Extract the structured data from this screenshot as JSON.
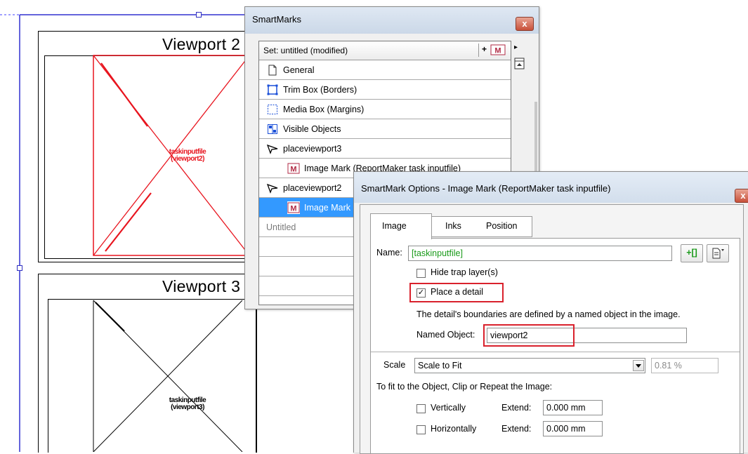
{
  "document": {
    "viewports": [
      {
        "title": "Viewport 2",
        "label_line1": "taskinputfile",
        "label_line2": "(viewport2)",
        "color": "#e8141e"
      },
      {
        "title": "Viewport 3",
        "label_line1": "taskinputfile",
        "label_line2": "(viewport3)",
        "color": "#000000"
      }
    ]
  },
  "smartmarks": {
    "title": "SmartMarks",
    "close_label": "x",
    "set_label": "Set: untitled (modified)",
    "add_label": "+",
    "add_icon": "image-mark-icon",
    "arrow_right": "▸",
    "items": [
      {
        "label": "General",
        "icon": "page-icon",
        "indent": 0
      },
      {
        "label": "Trim Box (Borders)",
        "icon": "trim-box-icon",
        "indent": 0
      },
      {
        "label": "Media Box (Margins)",
        "icon": "media-box-icon",
        "indent": 0
      },
      {
        "label": "Visible Objects",
        "icon": "visible-objects-icon",
        "indent": 0
      },
      {
        "label": "placeviewport3",
        "icon": "place-arrow-icon",
        "indent": 0
      },
      {
        "label": "Image Mark (ReportMaker task inputfile)",
        "icon": "image-mark-icon",
        "indent": 1
      },
      {
        "label": "placeviewport2",
        "icon": "place-arrow-icon",
        "indent": 0
      },
      {
        "label": "Image Mark",
        "icon": "image-mark-icon",
        "indent": 1,
        "selected": true
      },
      {
        "label": "Untitled",
        "icon": "",
        "indent": 0,
        "muted": true
      }
    ]
  },
  "options": {
    "title": "SmartMark Options - Image Mark (ReportMaker task inputfile)",
    "close_label": "x",
    "tabs": [
      "Image",
      "Inks",
      "Position"
    ],
    "active_tab": "Image",
    "name_label": "Name:",
    "name_value": "[taskinputfile]",
    "name_add_label": "+[]",
    "hide_trap_label": "Hide trap layer(s)",
    "hide_trap_checked": false,
    "place_detail_label": "Place a detail",
    "place_detail_checked": true,
    "detail_desc": "The detail's boundaries are defined by a named object in the image.",
    "named_object_label": "Named Object:",
    "named_object_value": "viewport2",
    "scale_label": "Scale",
    "scale_value": "Scale to Fit",
    "scale_percent": "0.81 %",
    "fit_desc": "To fit to the Object, Clip or Repeat the Image:",
    "vertically_label": "Vertically",
    "vertically_checked": false,
    "horizontally_label": "Horizontally",
    "horizontally_checked": false,
    "extend_label": "Extend:",
    "extend_v_value": "0.000 mm",
    "extend_h_value": "0.000 mm",
    "highlight_color": "#d9212c",
    "selection_color": "#3399ff"
  }
}
